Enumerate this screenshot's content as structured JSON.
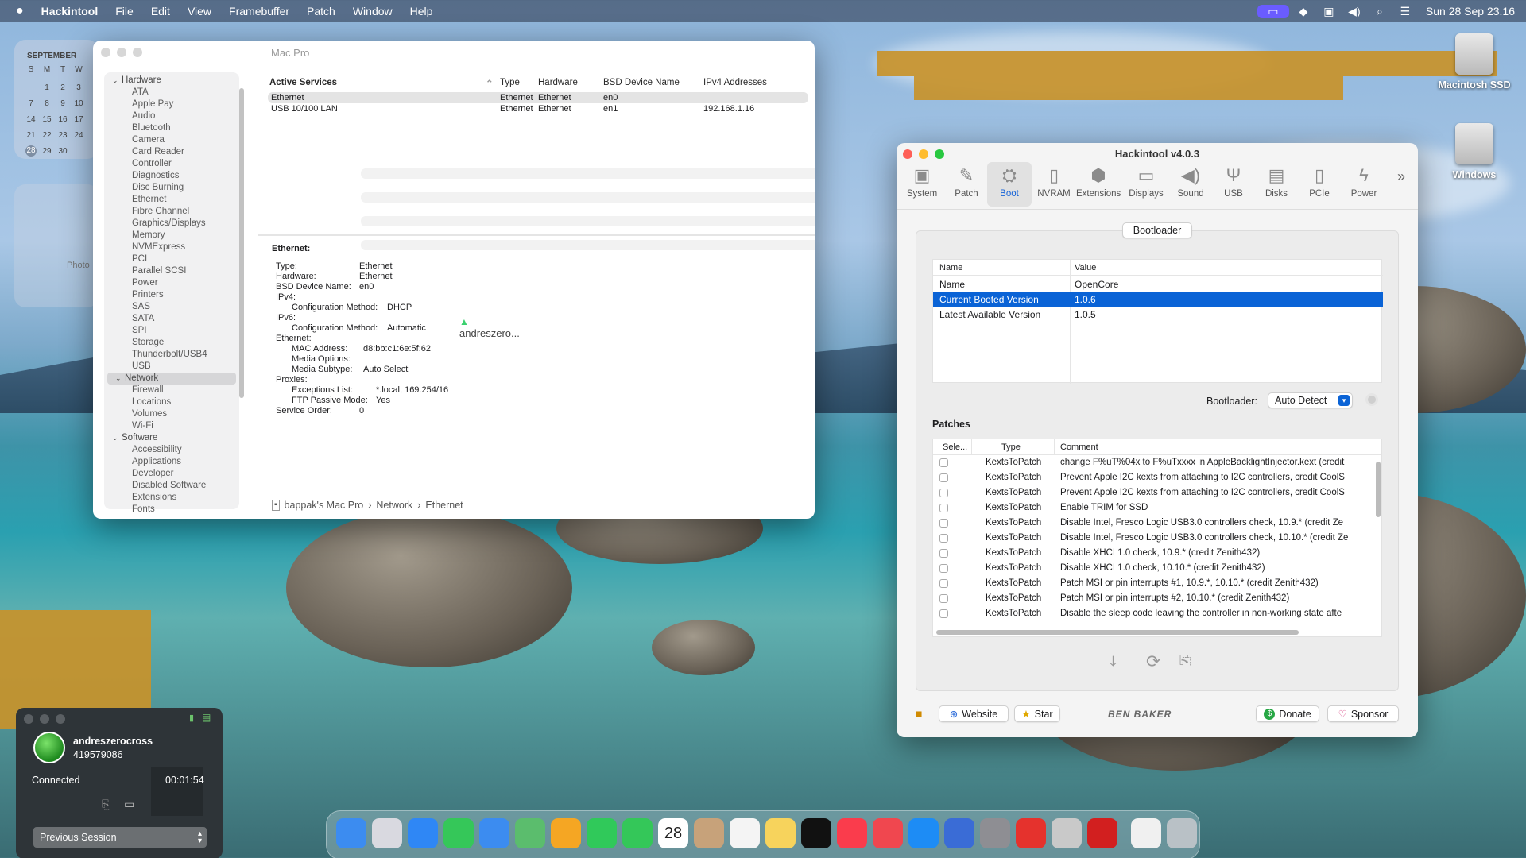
{
  "menubar": {
    "app": "Hackintool",
    "items": [
      "File",
      "Edit",
      "View",
      "Framebuffer",
      "Patch",
      "Window",
      "Help"
    ],
    "clock": "Sun 28 Sep  23.16"
  },
  "calendar": {
    "month": "SEPTEMBER",
    "days": [
      "S",
      "M",
      "T",
      "W"
    ],
    "rows": [
      [
        "",
        "1",
        "2",
        "3"
      ],
      [
        "7",
        "8",
        "9",
        "10"
      ],
      [
        "14",
        "15",
        "16",
        "17"
      ],
      [
        "21",
        "22",
        "23",
        "24"
      ],
      [
        "28",
        "29",
        "30",
        ""
      ]
    ],
    "today": "28"
  },
  "photos_widget": "Photo",
  "sysinfo": {
    "title": "Mac Pro",
    "sidebar": {
      "hardware": "Hardware",
      "hardware_items": [
        "ATA",
        "Apple Pay",
        "Audio",
        "Bluetooth",
        "Camera",
        "Card Reader",
        "Controller",
        "Diagnostics",
        "Disc Burning",
        "Ethernet",
        "Fibre Channel",
        "Graphics/Displays",
        "Memory",
        "NVMExpress",
        "PCI",
        "Parallel SCSI",
        "Power",
        "Printers",
        "SAS",
        "SATA",
        "SPI",
        "Storage",
        "Thunderbolt/USB4",
        "USB"
      ],
      "network": "Network",
      "network_items": [
        "Firewall",
        "Locations",
        "Volumes",
        "Wi-Fi"
      ],
      "software": "Software",
      "software_items": [
        "Accessibility",
        "Applications",
        "Developer",
        "Disabled Software",
        "Extensions",
        "Fonts"
      ]
    },
    "columns": [
      "Active Services",
      "Type",
      "Hardware",
      "BSD Device Name",
      "IPv4 Addresses"
    ],
    "rows": [
      {
        "service": "Ethernet",
        "type": "Ethernet",
        "hardware": "Ethernet",
        "bsd": "en0",
        "ipv4": ""
      },
      {
        "service": "USB 10/100 LAN",
        "type": "Ethernet",
        "hardware": "Ethernet",
        "bsd": "en1",
        "ipv4": "192.168.1.16"
      }
    ],
    "detail": {
      "heading": "Ethernet:",
      "lines": [
        {
          "k": "Type:",
          "v": "Ethernet"
        },
        {
          "k": "Hardware:",
          "v": "Ethernet"
        },
        {
          "k": "BSD Device Name:",
          "v": "en0"
        },
        {
          "k": "IPv4:",
          "v": ""
        },
        {
          "k": "Configuration Method:",
          "v": "DHCP"
        },
        {
          "k": "IPv6:",
          "v": ""
        },
        {
          "k": "Configuration Method:",
          "v": "Automatic"
        },
        {
          "k": "Ethernet:",
          "v": ""
        },
        {
          "k": "MAC Address:",
          "v": "d8:bb:c1:6e:5f:62"
        },
        {
          "k": "Media Options:",
          "v": ""
        },
        {
          "k": "Media Subtype:",
          "v": "Auto Select"
        },
        {
          "k": "Proxies:",
          "v": ""
        },
        {
          "k": "Exceptions List:",
          "v": "*.local, 169.254/16"
        },
        {
          "k": "FTP Passive Mode:",
          "v": "Yes"
        },
        {
          "k": "Service Order:",
          "v": "0"
        }
      ]
    },
    "cursor_label": "andreszero...",
    "breadcrumb": [
      "bappak's Mac Pro",
      "Network",
      "Ethernet"
    ]
  },
  "hackintool": {
    "title": "Hackintool v4.0.3",
    "tabs": [
      "System",
      "Patch",
      "Boot",
      "NVRAM",
      "Extensions",
      "Displays",
      "Sound",
      "USB",
      "Disks",
      "PCIe",
      "Power"
    ],
    "selected_tab": "Boot",
    "section": "Bootloader",
    "info_columns": [
      "Name",
      "Value"
    ],
    "info_rows": [
      {
        "name": "Name",
        "value": "OpenCore"
      },
      {
        "name": "Current Booted Version",
        "value": "1.0.6"
      },
      {
        "name": "Latest Available Version",
        "value": "1.0.5"
      }
    ],
    "bootloader_label": "Bootloader:",
    "bootloader_value": "Auto Detect",
    "patches_label": "Patches",
    "patch_columns": [
      "Sele...",
      "Type",
      "Comment"
    ],
    "patches": [
      {
        "type": "KextsToPatch",
        "comment": "change F%uT%04x to F%uTxxxx in AppleBacklightInjector.kext (credit"
      },
      {
        "type": "KextsToPatch",
        "comment": "Prevent Apple I2C kexts from attaching to I2C controllers, credit CoolS"
      },
      {
        "type": "KextsToPatch",
        "comment": "Prevent Apple I2C kexts from attaching to I2C controllers, credit CoolS"
      },
      {
        "type": "KextsToPatch",
        "comment": "Enable TRIM for SSD"
      },
      {
        "type": "KextsToPatch",
        "comment": "Disable Intel, Fresco Logic USB3.0 controllers check, 10.9.* (credit Ze"
      },
      {
        "type": "KextsToPatch",
        "comment": "Disable Intel, Fresco Logic USB3.0 controllers check, 10.10.* (credit Ze"
      },
      {
        "type": "KextsToPatch",
        "comment": "Disable XHCI 1.0 check, 10.9.* (credit Zenith432)"
      },
      {
        "type": "KextsToPatch",
        "comment": "Disable XHCI 1.0 check, 10.10.* (credit Zenith432)"
      },
      {
        "type": "KextsToPatch",
        "comment": "Patch MSI or pin interrupts #1, 10.9.*, 10.10.* (credit Zenith432)"
      },
      {
        "type": "KextsToPatch",
        "comment": "Patch MSI or pin interrupts #2, 10.10.* (credit Zenith432)"
      },
      {
        "type": "KextsToPatch",
        "comment": "Disable the sleep code leaving the controller in non-working state afte"
      }
    ],
    "website": "Website",
    "star": "Star",
    "brand": "BEN BAKER",
    "donate": "Donate",
    "sponsor": "Sponsor"
  },
  "session": {
    "user": "andreszerocross",
    "id": "419579086",
    "status": "Connected",
    "timer": "00:01:54",
    "previous": "Previous Session"
  },
  "desktop": {
    "drive1": "Macintosh SSD",
    "drive2": "Windows"
  },
  "dock": {
    "date": "28"
  }
}
